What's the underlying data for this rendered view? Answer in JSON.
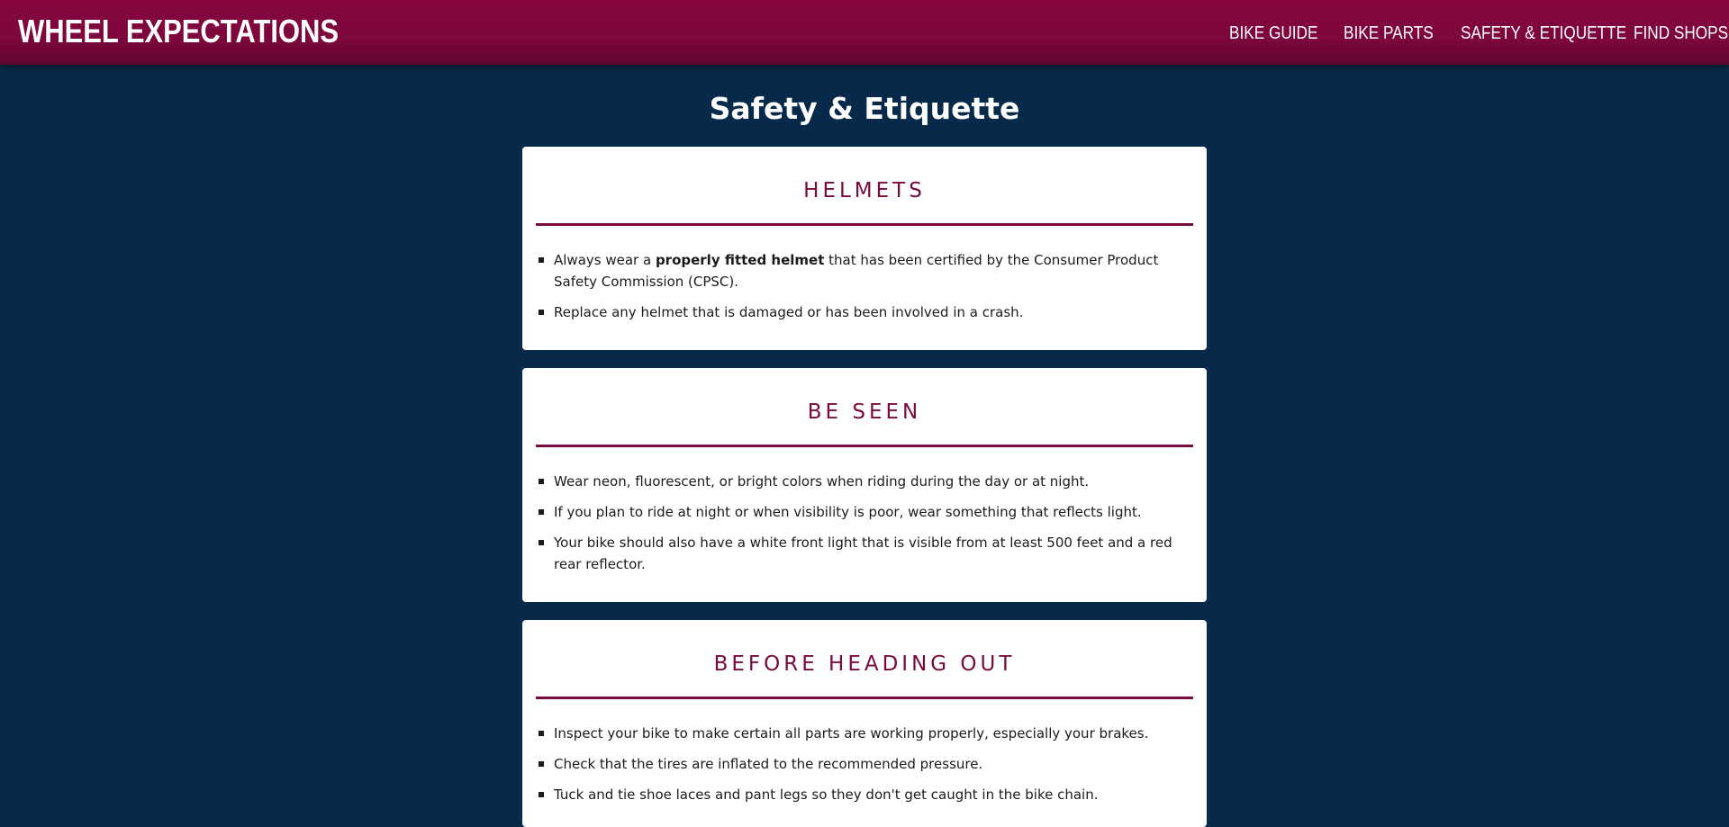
{
  "site": {
    "brand": "WHEEL EXPECTATIONS",
    "nav": [
      "BIKE GUIDE",
      "BIKE PARTS",
      "SAFETY & ETIQUETTE",
      "FIND SHOPS"
    ]
  },
  "page": {
    "title": "Safety & Etiquette"
  },
  "colors": {
    "navbar": "#86063f",
    "background": "#082a4a",
    "accent": "#7a0a3e",
    "card": "#ffffff"
  },
  "sections": {
    "helmets": {
      "heading": "HELMETS",
      "items": {
        "i0": {
          "pre": "Always wear a ",
          "bold": "properly fitted helmet",
          "post": " that has been certified by the Consumer Product Safety Commission (CPSC)."
        },
        "i1": "Replace any helmet that is damaged or has been involved in a crash."
      }
    },
    "be_seen": {
      "heading": "BE SEEN",
      "items": [
        "Wear neon, fluorescent, or bright colors when riding during the day or at night.",
        "If you plan to ride at night or when visibility is poor, wear something that reflects light.",
        "Your bike should also have a white front light that is visible from at least 500 feet and a red rear reflector."
      ]
    },
    "before_heading_out": {
      "heading": "BEFORE HEADING OUT",
      "items": [
        "Inspect your bike to make certain all parts are working properly, especially your brakes.",
        "Check that the tires are inflated to the recommended pressure.",
        "Tuck and tie shoe laces and pant legs so they don't get caught in the bike chain."
      ]
    }
  }
}
